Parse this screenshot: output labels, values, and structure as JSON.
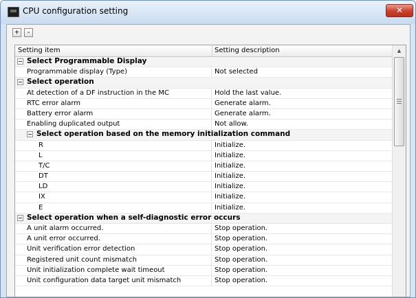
{
  "window": {
    "title": "CPU configuration setting",
    "close_label": "✕"
  },
  "toolbar": {
    "expand_label": "+",
    "collapse_label": "-"
  },
  "grid": {
    "header": {
      "col1": "Setting item",
      "col2": "Setting description"
    },
    "rows": [
      {
        "type": "group",
        "indent": 0,
        "label": "Select Programmable Display"
      },
      {
        "type": "item",
        "indent": 0,
        "label": "Programmable display (Type)",
        "value": "Not selected"
      },
      {
        "type": "group",
        "indent": 0,
        "label": "Select operation"
      },
      {
        "type": "item",
        "indent": 0,
        "label": "At detection of a DF instruction in the MC",
        "value": "Hold the last value."
      },
      {
        "type": "item",
        "indent": 0,
        "label": "RTC error alarm",
        "value": "Generate alarm."
      },
      {
        "type": "item",
        "indent": 0,
        "label": "Battery error alarm",
        "value": "Generate alarm."
      },
      {
        "type": "item",
        "indent": 0,
        "label": "Enabling duplicated output",
        "value": "Not allow."
      },
      {
        "type": "group",
        "indent": 1,
        "label": "Select operation based on the memory initialization command"
      },
      {
        "type": "item",
        "indent": 1,
        "label": "R",
        "value": "Initialize."
      },
      {
        "type": "item",
        "indent": 1,
        "label": "L",
        "value": "Initialize."
      },
      {
        "type": "item",
        "indent": 1,
        "label": "T/C",
        "value": "Initialize."
      },
      {
        "type": "item",
        "indent": 1,
        "label": "DT",
        "value": "Initialize."
      },
      {
        "type": "item",
        "indent": 1,
        "label": "LD",
        "value": "Initialize."
      },
      {
        "type": "item",
        "indent": 1,
        "label": "IX",
        "value": "Initialize."
      },
      {
        "type": "item",
        "indent": 1,
        "label": "E",
        "value": "Initialize."
      },
      {
        "type": "group",
        "indent": 0,
        "label": "Select operation when a self-diagnostic error occurs"
      },
      {
        "type": "item",
        "indent": 0,
        "label": "A unit alarm occurred.",
        "value": "Stop operation."
      },
      {
        "type": "item",
        "indent": 0,
        "label": "A unit error occurred.",
        "value": "Stop operation."
      },
      {
        "type": "item",
        "indent": 0,
        "label": "Unit verification error detection",
        "value": "Stop operation."
      },
      {
        "type": "item",
        "indent": 0,
        "label": "Registered unit count mismatch",
        "value": "Stop operation."
      },
      {
        "type": "item",
        "indent": 0,
        "label": "Unit initialization complete wait timeout",
        "value": "Stop operation."
      },
      {
        "type": "item",
        "indent": 0,
        "label": "Unit configuration data target unit mismatch",
        "value": "Stop operation."
      }
    ]
  },
  "scrollbar": {
    "up_glyph": "▲",
    "down_glyph": "▼"
  }
}
